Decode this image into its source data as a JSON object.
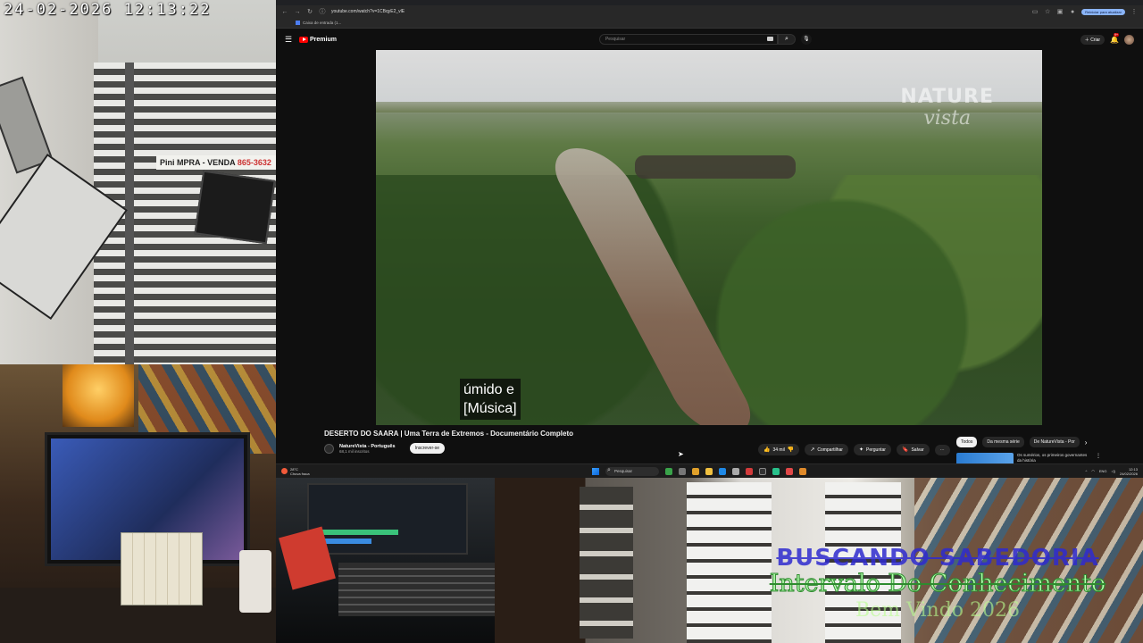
{
  "camera": {
    "timestamp": "24-02-2026  12:13:22",
    "sign_text": "Pini  MPRA - VENDA",
    "sign_phone": "865-3632"
  },
  "browser": {
    "url": "youtube.com/watch?v=1CBqyE2_vlE",
    "reload_button": "Reiniciar para atualizar",
    "bookmark": "Caixa de entrada (1..."
  },
  "youtube": {
    "logo": "Premium",
    "search_placeholder": "Pesquisar",
    "create_label": "Criar",
    "notif_badge": "9+",
    "watermark_line1": "NATURE",
    "watermark_line2": "vista",
    "captions": [
      "úmido e",
      "[Música]"
    ],
    "title": "DESERTO DO SAARA | Uma Terra de Extremos - Documentário Completo",
    "channel": "NatureVista - Português",
    "subscribers": "68,1 mil inscritos",
    "subscribe": "Inscrever-se",
    "likes": "34 mil",
    "share": "Compartilhar",
    "ask": "Perguntar",
    "save": "Salvar",
    "chips": [
      "Todos",
      "Da mesma série",
      "De NatureVista - Por"
    ],
    "suggestion_title": "Os sumérios, os primeiros governantes da história"
  },
  "taskbar": {
    "temp": "28°C",
    "weather": "Chuva fraca",
    "search": "Pesquisar",
    "lang": "ENG",
    "time": "12:13",
    "date": "24/02/2026"
  },
  "overlay": {
    "line1": "BUSCANDO SABEDORIA",
    "line2": "Intervalo Do Conhecimento",
    "line3": "Bem Vindo 2026"
  },
  "colors": {
    "youtube_red": "#ff0000",
    "overlay_blue": "#2f2bcf",
    "overlay_green": "#b6ffb0"
  }
}
